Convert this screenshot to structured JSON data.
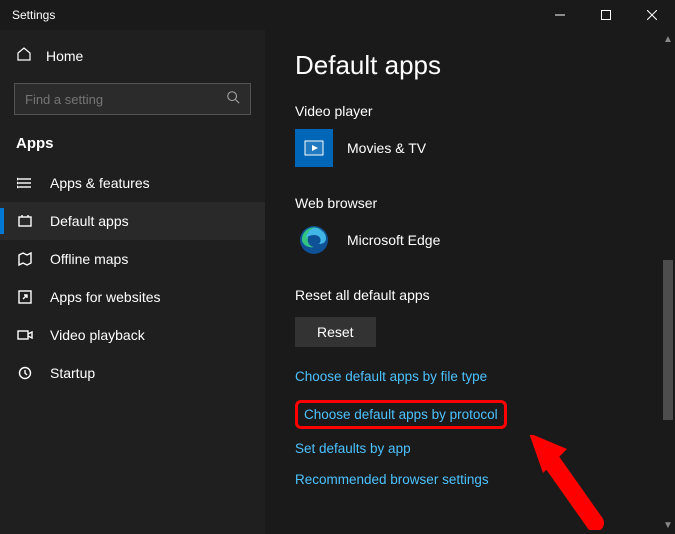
{
  "titlebar": {
    "title": "Settings"
  },
  "sidebar": {
    "home_label": "Home",
    "search_placeholder": "Find a setting",
    "section_label": "Apps",
    "items": [
      {
        "label": "Apps & features"
      },
      {
        "label": "Default apps"
      },
      {
        "label": "Offline maps"
      },
      {
        "label": "Apps for websites"
      },
      {
        "label": "Video playback"
      },
      {
        "label": "Startup"
      }
    ]
  },
  "main": {
    "page_title": "Default apps",
    "video_player_label": "Video player",
    "video_player_app": "Movies & TV",
    "web_browser_label": "Web browser",
    "web_browser_app": "Microsoft Edge",
    "reset_heading": "Reset all default apps",
    "reset_button": "Reset",
    "links": {
      "by_file_type": "Choose default apps by file type",
      "by_protocol": "Choose default apps by protocol",
      "by_app": "Set defaults by app",
      "recommended": "Recommended browser settings"
    }
  }
}
